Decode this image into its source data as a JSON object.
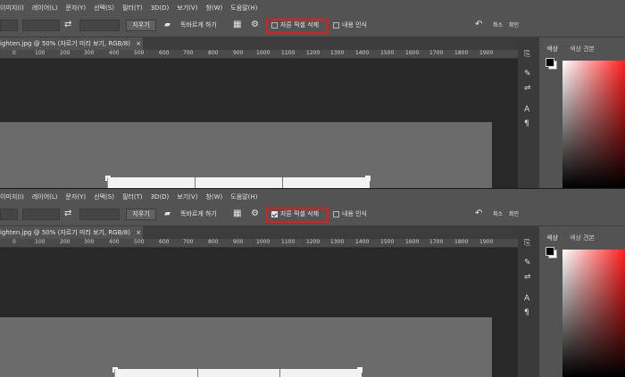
{
  "menu": [
    "이미지(I)",
    "레이어(L)",
    "문자(Y)",
    "선택(S)",
    "필터(T)",
    "3D(D)",
    "보기(V)",
    "창(W)",
    "도움말(H)"
  ],
  "options": {
    "clear_label": "지우기",
    "straighten_label": "똑바르게 하기",
    "delete_cropped_label": "자른 픽셀 삭제",
    "content_aware_label": "내용 인식",
    "cancel_label": "취소",
    "commit_label": "확인"
  },
  "document_tab": "ighten.jpg @ 50% (자르기 미리 보기, RGB/8)",
  "ruler_ticks": [
    "0",
    "100",
    "200",
    "300",
    "400",
    "500",
    "600",
    "700",
    "800",
    "900",
    "1000",
    "1100",
    "1200",
    "1300",
    "1400",
    "1500",
    "1600",
    "1700",
    "1800",
    "1900"
  ],
  "right_panel": {
    "tab_color": "색상",
    "tab_swatches": "색상 견본"
  },
  "states": [
    {
      "delete_cropped_checked": false
    },
    {
      "delete_cropped_checked": true
    }
  ],
  "colors": {
    "highlight": "#e01b1b",
    "ui_bg": "#535353",
    "canvas_bg": "#282828"
  }
}
